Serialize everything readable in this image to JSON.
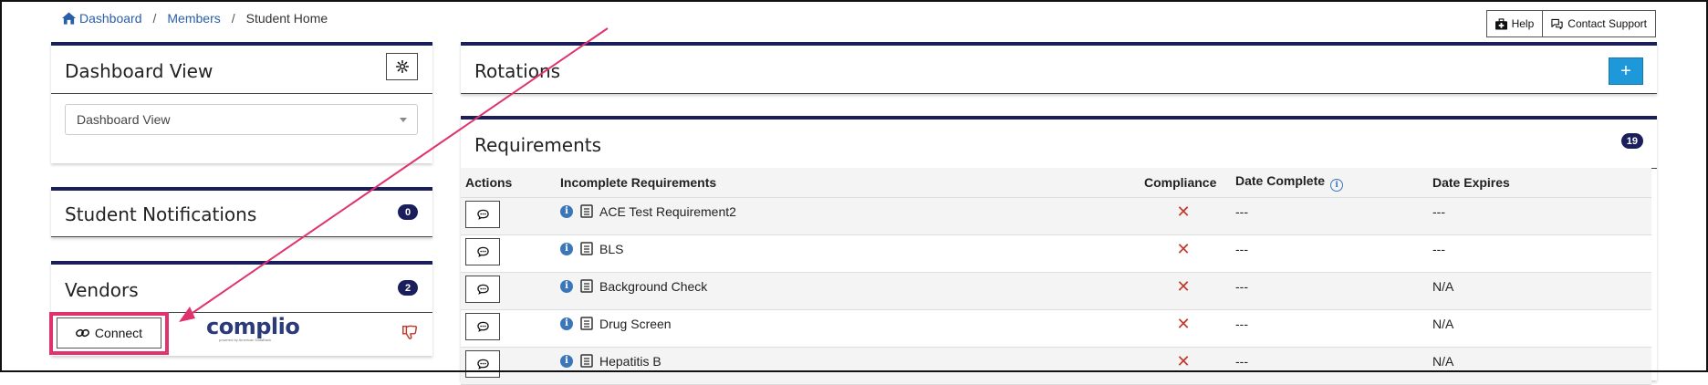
{
  "breadcrumb": {
    "items": [
      "Dashboard",
      "Members",
      "Student Home"
    ],
    "separator": "/"
  },
  "header_actions": {
    "help_label": "Help",
    "contact_label": "Contact Support"
  },
  "dashboard_view": {
    "title": "Dashboard View",
    "select_value": "Dashboard View"
  },
  "notifications": {
    "title": "Student Notifications",
    "count": "0"
  },
  "vendors": {
    "title": "Vendors",
    "count": "2",
    "connect_label": "Connect",
    "vendor_name": "complio",
    "vendor_tagline": "powered by American DataBank"
  },
  "rotations": {
    "title": "Rotations",
    "add_label": "+"
  },
  "requirements": {
    "title": "Requirements",
    "count": "19",
    "columns": {
      "actions": "Actions",
      "incomplete": "Incomplete Requirements",
      "compliance": "Compliance",
      "date_complete": "Date Complete",
      "date_expires": "Date Expires"
    },
    "rows": [
      {
        "name": "ACE Test Requirement2",
        "compliance": "✕",
        "date_complete": "---",
        "date_expires": "---"
      },
      {
        "name": "BLS",
        "compliance": "✕",
        "date_complete": "---",
        "date_expires": "---"
      },
      {
        "name": "Background Check",
        "compliance": "✕",
        "date_complete": "---",
        "date_expires": "N/A"
      },
      {
        "name": "Drug Screen",
        "compliance": "✕",
        "date_complete": "---",
        "date_expires": "N/A"
      },
      {
        "name": "Hepatitis B",
        "compliance": "✕",
        "date_complete": "---",
        "date_expires": "N/A"
      }
    ]
  },
  "colors": {
    "card_accent": "#1a1f5c",
    "link": "#2a5ea8",
    "primary_button": "#1e98d8",
    "highlight": "#e0336e",
    "noncompliant": "#c0392b"
  }
}
